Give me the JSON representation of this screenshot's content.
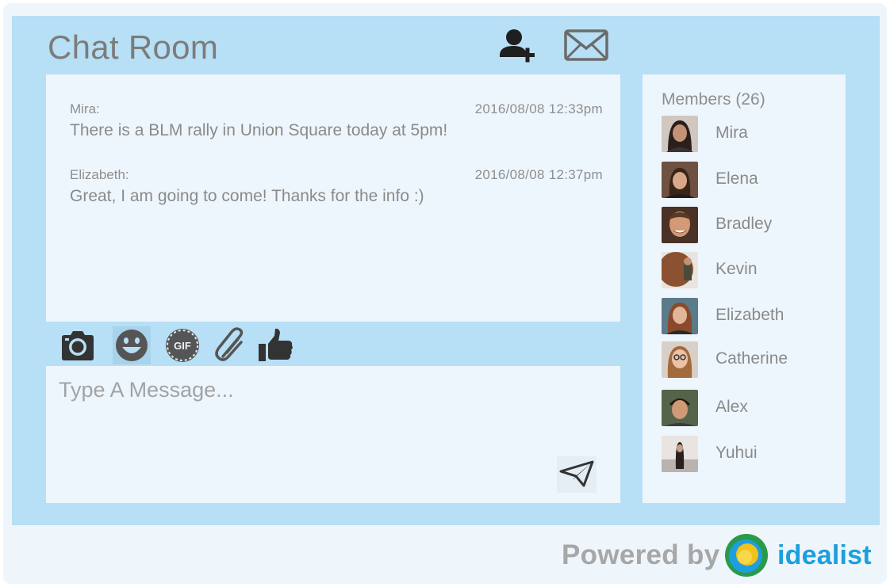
{
  "header": {
    "title": "Chat Room",
    "add_member_icon": "add-user-icon",
    "mail_icon": "envelope-icon"
  },
  "messages": [
    {
      "author": "Mira:",
      "timestamp": "2016/08/08  12:33pm",
      "text": "There is a BLM rally in Union Square today at 5pm!"
    },
    {
      "author": "Elizabeth:",
      "timestamp": "2016/08/08  12:37pm",
      "text": "Great, I am going to come! Thanks for the info :)"
    }
  ],
  "toolbar": [
    "camera-icon",
    "smiley-icon",
    "gif-icon",
    "paperclip-icon",
    "thumbs-up-icon"
  ],
  "composer": {
    "placeholder": "Type A Message...",
    "value": "",
    "send_icon": "paper-plane-icon"
  },
  "members": {
    "title": "Members (26)",
    "items": [
      {
        "name": "Mira"
      },
      {
        "name": "Elena"
      },
      {
        "name": "Bradley"
      },
      {
        "name": "Kevin"
      },
      {
        "name": "Elizabeth"
      },
      {
        "name": "Catherine"
      },
      {
        "name": "Alex"
      },
      {
        "name": "Yuhui"
      }
    ]
  },
  "footer": {
    "powered_by": "Powered by",
    "brand": "idealist"
  },
  "colors": {
    "frame": "#b7dff5",
    "panel": "#eef6fd",
    "text": "#8a8a8a",
    "icon": "#444444",
    "brand": "#1b9fe0"
  }
}
